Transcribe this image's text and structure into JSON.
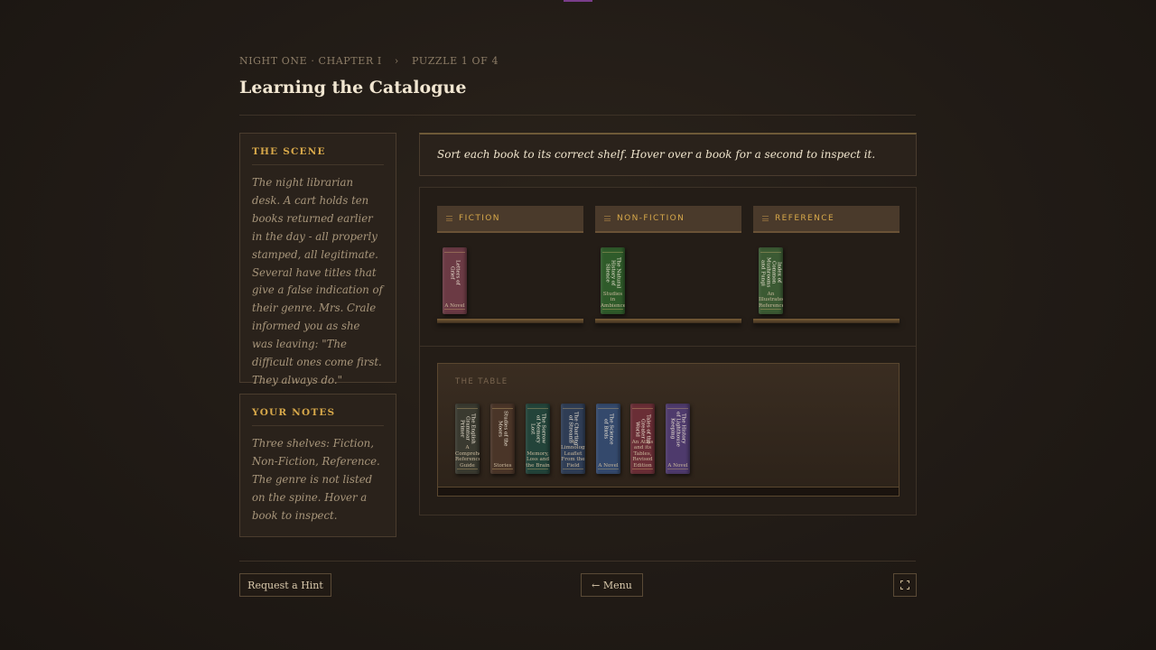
{
  "breadcrumb": {
    "chapter": "NIGHT ONE · CHAPTER I",
    "separator": "›",
    "puzzle": "PUZZLE 1 OF 4"
  },
  "title": "Learning the Catalogue",
  "scene": {
    "heading": "THE SCENE",
    "text": "The night librarian desk. A cart holds ten books returned earlier in the day - all properly stamped, all legitimate. Several have titles that give a false indication of their genre. Mrs. Crale informed you as she was leaving: \"The difficult ones come first. They always do.\""
  },
  "notes": {
    "heading": "YOUR NOTES",
    "text": "Three shelves: Fiction, Non-Fiction, Reference. The genre is not listed on the spine. Hover a book to inspect."
  },
  "instructions": "Sort each book to its correct shelf. Hover over a book for a second to inspect it.",
  "shelves": [
    {
      "label": "FICTION",
      "icon": "lines-icon",
      "books": [
        {
          "title": "Letters of Grief",
          "subtitle": "A Novel",
          "color": "#6b3a44"
        }
      ]
    },
    {
      "label": "NON-FICTION",
      "icon": "lines-icon",
      "books": [
        {
          "title": "The Natural History of Silence",
          "subtitle": "Studies in Ambience",
          "color": "#2f5b2a"
        }
      ]
    },
    {
      "label": "REFERENCE",
      "icon": "lines-icon",
      "books": [
        {
          "title": "Index of Common Mushrooms and Fungi",
          "subtitle": "An Illustrated Reference",
          "color": "#3b5a33"
        }
      ]
    }
  ],
  "table": {
    "label": "THE TABLE",
    "books": [
      {
        "title": "The English Grammar Primer",
        "subtitle": "A Comprehensive Reference Guide",
        "color": "#3a3a30"
      },
      {
        "title": "Studies of the Moors",
        "subtitle": "Stories",
        "color": "#4a3528"
      },
      {
        "title": "The Sorrow of Memory Lost",
        "subtitle": "Memory, Loss and the Brain",
        "color": "#23443a"
      },
      {
        "title": "The Charting of Streams",
        "subtitle": "A Limnologist's Leaflet From the Field",
        "color": "#2f3d55"
      },
      {
        "title": "The Science of Birds",
        "subtitle": "A Novel",
        "color": "#34496c"
      },
      {
        "title": "Tales of the Greater World",
        "subtitle": "An Atlas and its Tables, Revised Edition",
        "color": "#6a2e36"
      },
      {
        "title": "The History of Lighthouse Keeping",
        "subtitle": "A Novel",
        "color": "#4e3a6c"
      }
    ]
  },
  "footer": {
    "hint": "Request a Hint",
    "menu": "← Menu",
    "fullscreen_icon": "expand-icon"
  },
  "colors": {
    "accent": "#d7a84a",
    "background": "#211b16",
    "panel": "#2a221b",
    "border": "#4a3c2e"
  }
}
